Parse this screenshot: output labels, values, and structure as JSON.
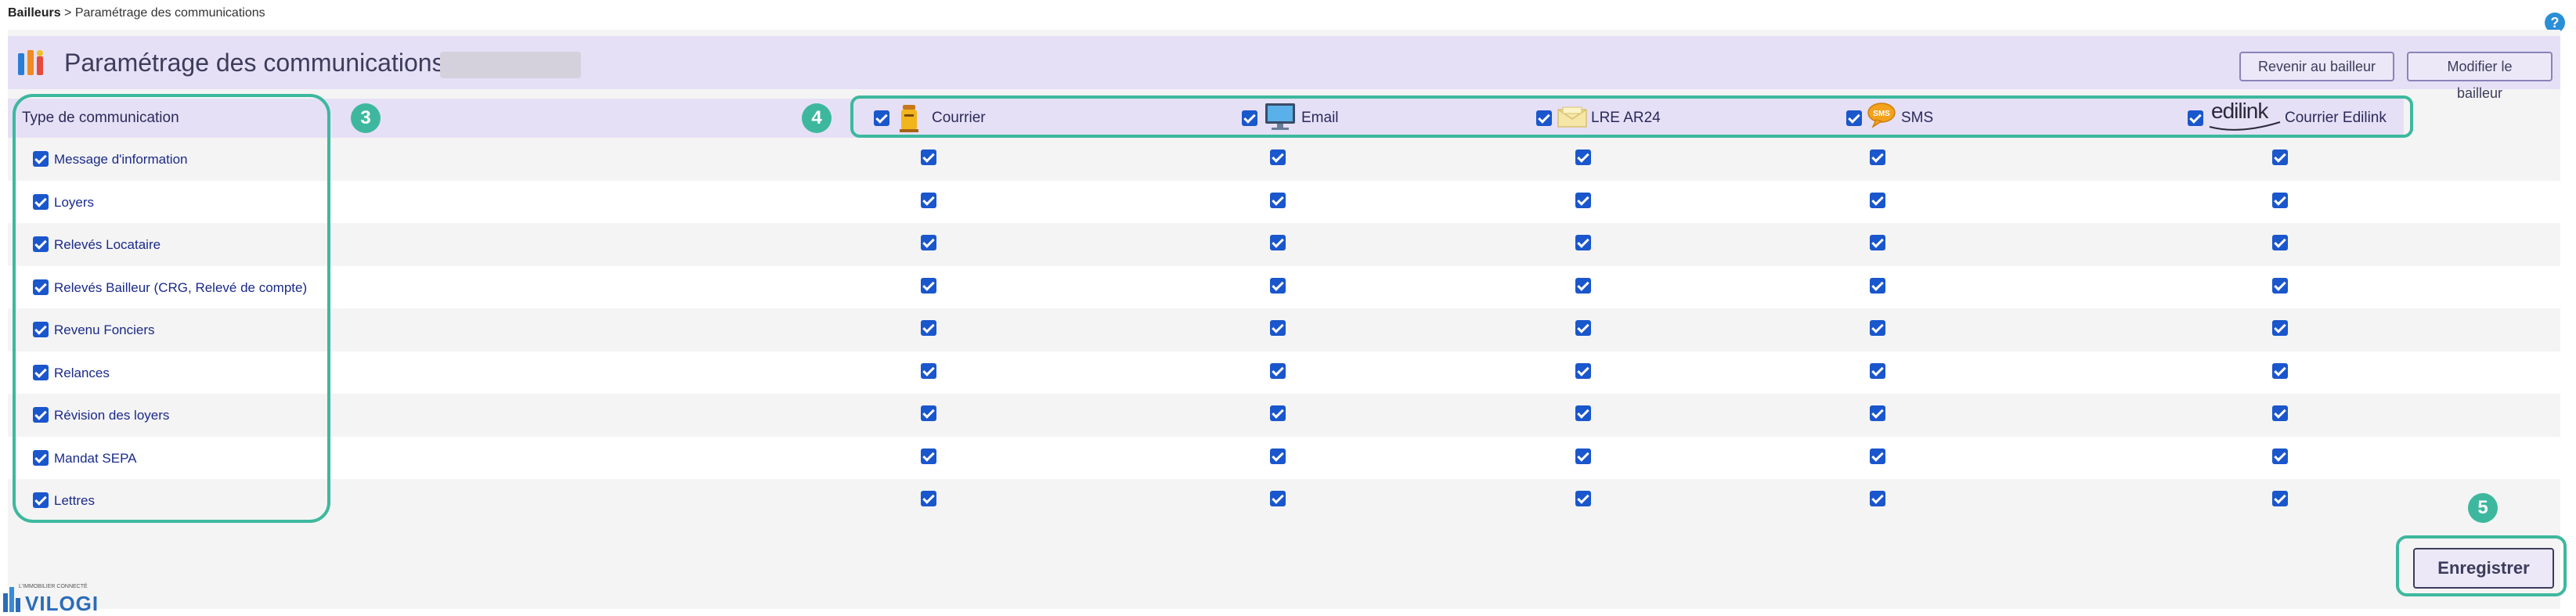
{
  "breadcrumb": {
    "root": "Bailleurs",
    "sep": " > ",
    "current": "Paramétrage des communications"
  },
  "help": {
    "symbol": "?"
  },
  "header": {
    "title": "Paramétrage des communications :",
    "buttons": {
      "back": "Revenir au bailleur",
      "edit": "Modifier le bailleur"
    }
  },
  "table": {
    "type_header": "Type de communication",
    "columns": [
      {
        "key": "courrier",
        "label": "Courrier",
        "icon": "mailbox-icon"
      },
      {
        "key": "email",
        "label": "Email",
        "icon": "computer-icon"
      },
      {
        "key": "lre",
        "label": "LRE AR24",
        "icon": "envelope-icon"
      },
      {
        "key": "sms",
        "label": "SMS",
        "icon": "sms-bubble-icon"
      },
      {
        "key": "edilink",
        "label": "Courrier Edilink",
        "icon": "edilink-logo",
        "logo_text": "edilink"
      }
    ],
    "rows": [
      {
        "label": "Message d'information",
        "checked": [
          true,
          true,
          true,
          true,
          true
        ]
      },
      {
        "label": "Loyers",
        "checked": [
          true,
          true,
          true,
          true,
          true
        ]
      },
      {
        "label": "Relevés Locataire",
        "checked": [
          true,
          true,
          true,
          true,
          true
        ]
      },
      {
        "label": "Relevés Bailleur (CRG, Relevé de compte)",
        "checked": [
          true,
          true,
          true,
          true,
          true
        ]
      },
      {
        "label": "Revenu Fonciers",
        "checked": [
          true,
          true,
          true,
          true,
          true
        ]
      },
      {
        "label": "Relances",
        "checked": [
          true,
          true,
          true,
          true,
          true
        ]
      },
      {
        "label": "Révision des loyers",
        "checked": [
          true,
          true,
          true,
          true,
          true
        ]
      },
      {
        "label": "Mandat SEPA",
        "checked": [
          true,
          true,
          true,
          true,
          true
        ]
      },
      {
        "label": "Lettres",
        "checked": [
          true,
          true,
          true,
          true,
          true
        ]
      }
    ]
  },
  "annotations": {
    "types": "3",
    "media": "4",
    "save": "5"
  },
  "save_button": "Enregistrer",
  "logo": {
    "name": "VILOGI",
    "tagline": "L'IMMOBILIER CONNECTÉ"
  },
  "colors": {
    "accent": "#3db89e",
    "header_bg": "#e6e0f6",
    "checkbox": "#1a56cc"
  }
}
